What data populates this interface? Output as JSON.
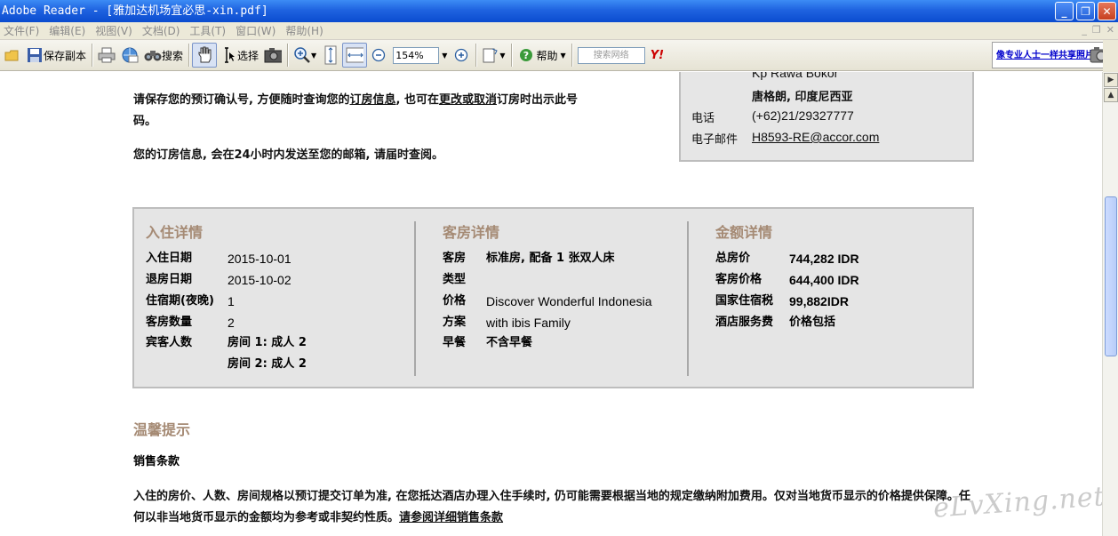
{
  "window": {
    "title": "Adobe Reader - [雅加达机场宜必思-xin.pdf]",
    "minimize": "_",
    "restore": "❐",
    "close": "✕"
  },
  "menu": {
    "items": [
      "文件(F)",
      "编辑(E)",
      "视图(V)",
      "文档(D)",
      "工具(T)",
      "窗口(W)",
      "帮助(H)"
    ],
    "mdi_buttons": [
      "_",
      "❐",
      "✕"
    ]
  },
  "toolbar": {
    "save_copy": "保存副本",
    "search": "搜索",
    "select": "选择",
    "zoom_value": "154%",
    "help": "帮助",
    "search_web_placeholder": "搜索网络",
    "yahoo": "Y!",
    "ad_text": "像专业人士一样共享照片"
  },
  "doc": {
    "top_partial": "…",
    "para1_a": "请保存您的预订确认号, 方便随时查询您的",
    "para1_link1": "订房信息",
    "para1_b": ", 也可在",
    "para1_link2": "更改或取消",
    "para1_c": "订房时出示此号",
    "para1_d": "码。",
    "para2": "您的订房信息, 会在24小时内发送至您的邮箱, 请届时查阅。",
    "hotel": {
      "address1": "Kp Rawa Bokor",
      "address2": "唐格朗, 印度尼西亚",
      "phone_label": "电话",
      "phone": "(+62)21/29327777",
      "email_label": "电子邮件",
      "email": "H8593-RE@accor.com"
    },
    "checkin": {
      "title": "入住详情",
      "checkin_label": "入住日期",
      "checkin_date": "2015-10-01",
      "checkout_label": "退房日期",
      "checkout_date": "2015-10-02",
      "nights_label": "住宿期(夜晚)",
      "nights": "1",
      "rooms_label": "客房数量",
      "rooms": "2",
      "guests_label": "宾客人数",
      "guests_room1": "房间 1: 成人 2",
      "guests_room2": "房间 2: 成人 2"
    },
    "room": {
      "title": "客房详情",
      "type_label_1": "客房",
      "type_label_2": "类型",
      "type_value": "标准房, 配备 1 张双人床",
      "rate_label_1": "价格",
      "rate_label_2": "方案",
      "rate_value_1": "Discover Wonderful Indonesia",
      "rate_value_2": "with ibis Family",
      "breakfast_label": "早餐",
      "breakfast_value": "不含早餐"
    },
    "amount": {
      "title": "金额详情",
      "total_label": "总房价",
      "total": "744,282 IDR",
      "room_price_label": "客房价格",
      "room_price": "644,400 IDR",
      "tax_label": "国家住宿税",
      "tax": "99,882IDR",
      "service_label": "酒店服务费",
      "service": "价格包括"
    },
    "tips_title": "温馨提示",
    "sales_title": "销售条款",
    "sales_para": "入住的房价、人数、房间规格以预订提交订单为准, 在您抵达酒店办理入住手续时, 仍可能需要根据当地的规定缴纳附加费用。仅对当地货币显示的价格提供保障。任何以非当地货币显示的金额均为参考或非契约性质。",
    "sales_link": "请参阅详细销售条款"
  },
  "watermark": "eLvXing.net",
  "colors": {
    "titlebar": "#1f63e0",
    "section_title": "#a58a74",
    "panel_bg": "#e5e5e5"
  }
}
